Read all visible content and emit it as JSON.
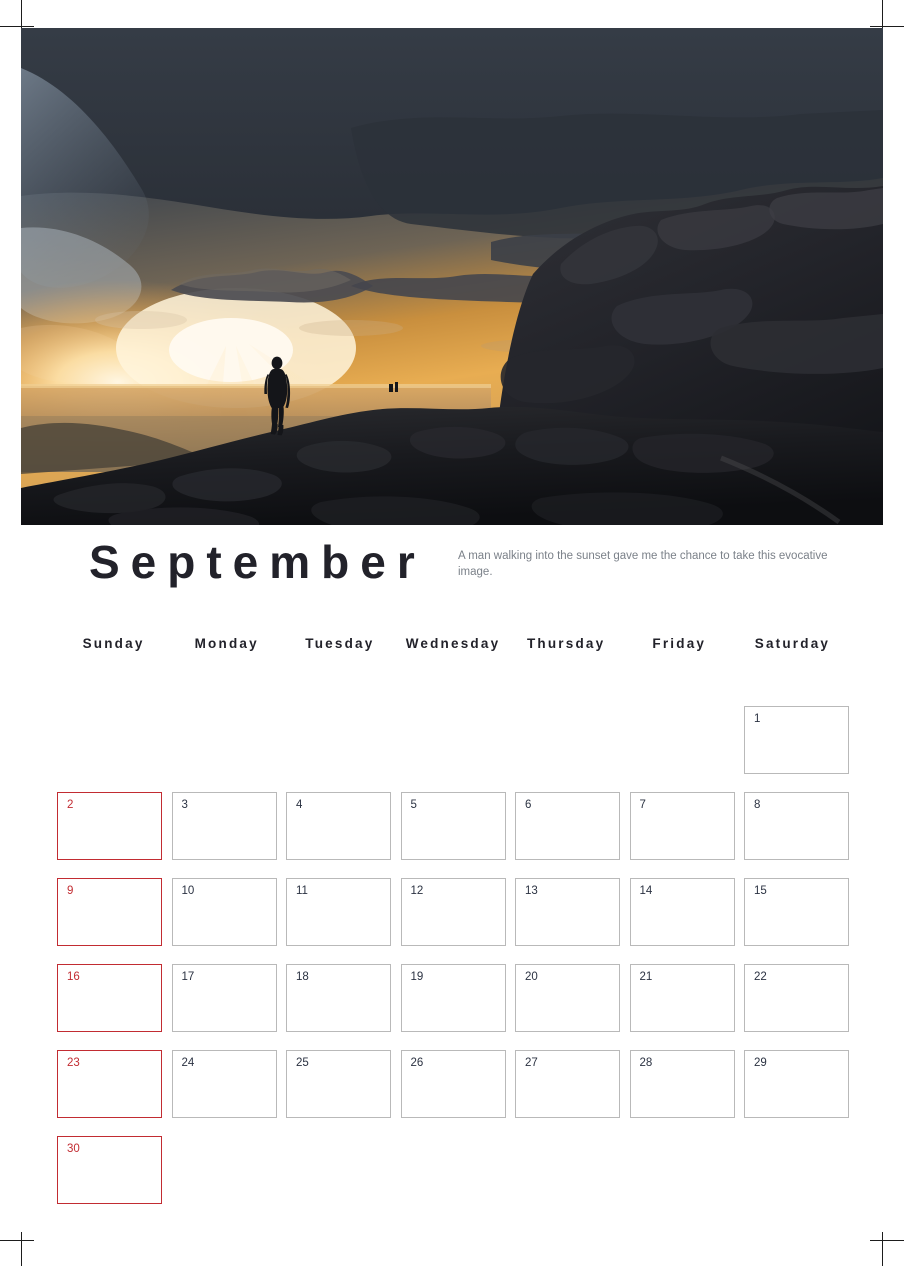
{
  "page": {
    "month_title": "September",
    "description": "A man walking into the sunset gave me the chance to take this evocative image.",
    "photo_alt": "Silhouette of a man walking toward a golden sunset on a dark rocky mountain ridge under heavy clouds",
    "accent_color": "#c22c32",
    "cell_border_color": "#b9b9b9",
    "title_color": "#22222a",
    "note_color": "#7b8189",
    "daynum_color": "#2b3242"
  },
  "weekdays": [
    {
      "label": "Sunday"
    },
    {
      "label": "Monday"
    },
    {
      "label": "Tuesday"
    },
    {
      "label": "Wednesday"
    },
    {
      "label": "Thursday"
    },
    {
      "label": "Friday"
    },
    {
      "label": "Saturday"
    }
  ],
  "days": [
    {
      "label": "",
      "empty": true,
      "sunday": false
    },
    {
      "label": "",
      "empty": true,
      "sunday": false
    },
    {
      "label": "",
      "empty": true,
      "sunday": false
    },
    {
      "label": "",
      "empty": true,
      "sunday": false
    },
    {
      "label": "",
      "empty": true,
      "sunday": false
    },
    {
      "label": "",
      "empty": true,
      "sunday": false
    },
    {
      "label": "1",
      "empty": false,
      "sunday": false
    },
    {
      "label": "2",
      "empty": false,
      "sunday": true
    },
    {
      "label": "3",
      "empty": false,
      "sunday": false
    },
    {
      "label": "4",
      "empty": false,
      "sunday": false
    },
    {
      "label": "5",
      "empty": false,
      "sunday": false
    },
    {
      "label": "6",
      "empty": false,
      "sunday": false
    },
    {
      "label": "7",
      "empty": false,
      "sunday": false
    },
    {
      "label": "8",
      "empty": false,
      "sunday": false
    },
    {
      "label": "9",
      "empty": false,
      "sunday": true
    },
    {
      "label": "10",
      "empty": false,
      "sunday": false
    },
    {
      "label": "11",
      "empty": false,
      "sunday": false
    },
    {
      "label": "12",
      "empty": false,
      "sunday": false
    },
    {
      "label": "13",
      "empty": false,
      "sunday": false
    },
    {
      "label": "14",
      "empty": false,
      "sunday": false
    },
    {
      "label": "15",
      "empty": false,
      "sunday": false
    },
    {
      "label": "16",
      "empty": false,
      "sunday": true
    },
    {
      "label": "17",
      "empty": false,
      "sunday": false
    },
    {
      "label": "18",
      "empty": false,
      "sunday": false
    },
    {
      "label": "19",
      "empty": false,
      "sunday": false
    },
    {
      "label": "20",
      "empty": false,
      "sunday": false
    },
    {
      "label": "21",
      "empty": false,
      "sunday": false
    },
    {
      "label": "22",
      "empty": false,
      "sunday": false
    },
    {
      "label": "23",
      "empty": false,
      "sunday": true
    },
    {
      "label": "24",
      "empty": false,
      "sunday": false
    },
    {
      "label": "25",
      "empty": false,
      "sunday": false
    },
    {
      "label": "26",
      "empty": false,
      "sunday": false
    },
    {
      "label": "27",
      "empty": false,
      "sunday": false
    },
    {
      "label": "28",
      "empty": false,
      "sunday": false
    },
    {
      "label": "29",
      "empty": false,
      "sunday": false
    },
    {
      "label": "30",
      "empty": false,
      "sunday": true
    },
    {
      "label": "",
      "empty": true,
      "sunday": false
    },
    {
      "label": "",
      "empty": true,
      "sunday": false
    },
    {
      "label": "",
      "empty": true,
      "sunday": false
    },
    {
      "label": "",
      "empty": true,
      "sunday": false
    },
    {
      "label": "",
      "empty": true,
      "sunday": false
    },
    {
      "label": "",
      "empty": true,
      "sunday": false
    }
  ]
}
